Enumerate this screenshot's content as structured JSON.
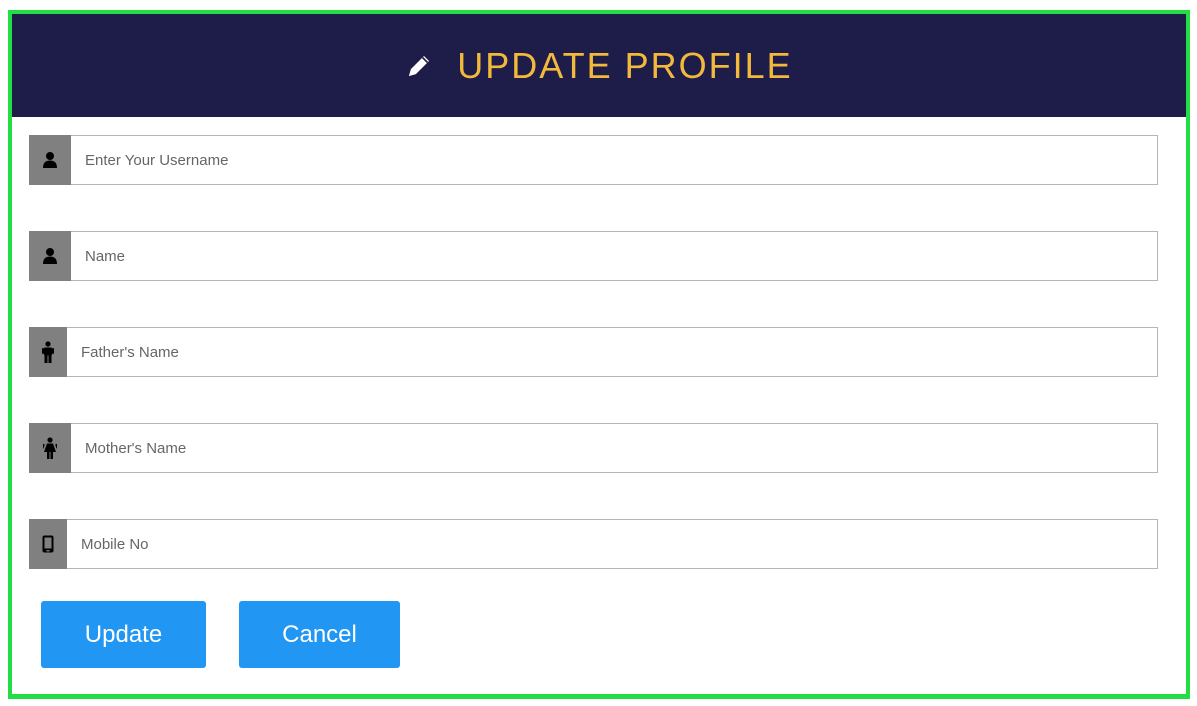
{
  "header": {
    "icon": "pencil-icon",
    "title": "UPDATE PROFILE",
    "title_color": "#f2b93b",
    "background_color": "#1e1d4a"
  },
  "form": {
    "fields": [
      {
        "icon": "user-icon",
        "placeholder": "Enter Your Username",
        "value": ""
      },
      {
        "icon": "user-icon",
        "placeholder": "Name",
        "value": ""
      },
      {
        "icon": "male-icon",
        "placeholder": "Father's Name",
        "value": ""
      },
      {
        "icon": "female-icon",
        "placeholder": "Mother's Name",
        "value": ""
      },
      {
        "icon": "mobile-icon",
        "placeholder": "Mobile No",
        "value": ""
      }
    ]
  },
  "buttons": {
    "update_label": "Update",
    "cancel_label": "Cancel",
    "color": "#2196f3"
  },
  "frame_border_color": "#22dd44"
}
